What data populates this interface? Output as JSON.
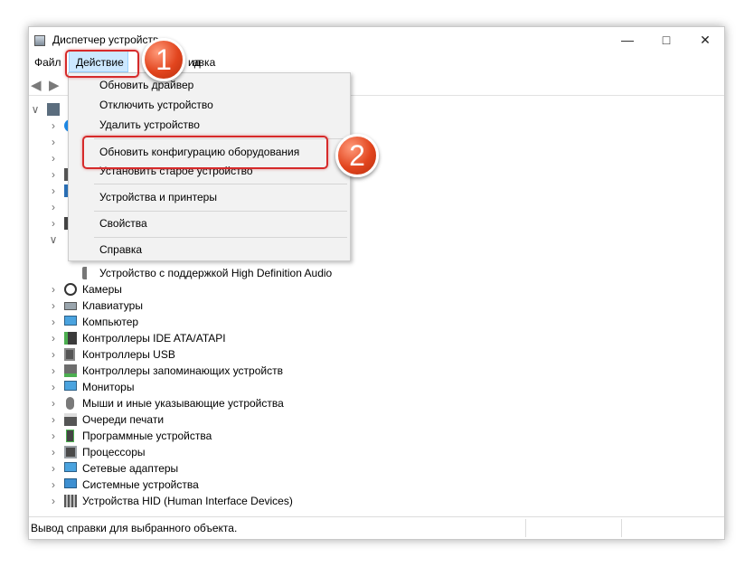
{
  "window": {
    "title": "Диспетчер устройств"
  },
  "menubar": {
    "file": "Файл",
    "action": "Действие",
    "view_partial": "ид",
    "help_partial": "авка"
  },
  "action_menu": {
    "items": [
      "Обновить драйвер",
      "Отключить устройство",
      "Удалить устройство",
      "Обновить конфигурацию оборудования",
      "Установить старое устройство",
      "Устройства и принтеры",
      "Свойства",
      "Справка"
    ]
  },
  "tree": {
    "audio_child": "Устройство с поддержкой High Definition Audio",
    "categories": [
      "Камеры",
      "Клавиатуры",
      "Компьютер",
      "Контроллеры IDE ATA/ATAPI",
      "Контроллеры USB",
      "Контроллеры запоминающих устройств",
      "Мониторы",
      "Мыши и иные указывающие устройства",
      "Очереди печати",
      "Программные устройства",
      "Процессоры",
      "Сетевые адаптеры",
      "Системные устройства",
      "Устройства HID (Human Interface Devices)"
    ]
  },
  "status": {
    "text": "Вывод справки для выбранного объекта."
  },
  "badges": {
    "step1": "1",
    "step2": "2"
  },
  "colors": {
    "highlight": "#d62a2a",
    "badge": "#e2451e",
    "menu_selected": "#cce8ff"
  }
}
